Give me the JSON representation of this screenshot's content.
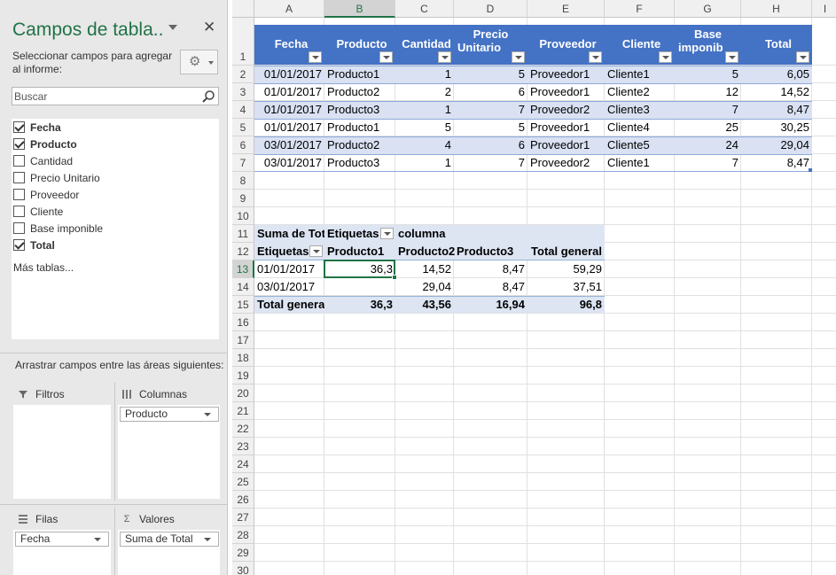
{
  "pane": {
    "title": "Campos de tabla..",
    "close_glyph": "✕",
    "subtitle": "Seleccionar campos para agregar al informe:",
    "search_placeholder": "Buscar",
    "fields": [
      {
        "label": "Fecha",
        "checked": true
      },
      {
        "label": "Producto",
        "checked": true
      },
      {
        "label": "Cantidad",
        "checked": false
      },
      {
        "label": "Precio Unitario",
        "checked": false
      },
      {
        "label": "Proveedor",
        "checked": false
      },
      {
        "label": "Cliente",
        "checked": false
      },
      {
        "label": "Base imponible",
        "checked": false
      },
      {
        "label": "Total",
        "checked": true
      }
    ],
    "more_tables": "Más tablas...",
    "drag_label": "Arrastrar campos entre las áreas siguientes:",
    "areas": {
      "filters": {
        "label": "Filtros",
        "icon": "filter-icon"
      },
      "columns": {
        "label": "Columnas",
        "icon": "columns-icon",
        "item": "Producto"
      },
      "rows": {
        "label": "Filas",
        "icon": "rows-icon",
        "item": "Fecha"
      },
      "values": {
        "label": "Valores",
        "icon": "sigma-icon",
        "item": "Suma de Total"
      }
    }
  },
  "sheet": {
    "columns": [
      "A",
      "B",
      "C",
      "D",
      "E",
      "F",
      "G",
      "H",
      "I"
    ],
    "active_column": "B",
    "active_row": 13,
    "visible_rows": 30,
    "table": {
      "headers": [
        "Fecha",
        "Producto",
        "Cantidad",
        "Precio Unitario",
        "Proveedor",
        "Cliente",
        "Base imponible",
        "Total"
      ],
      "header_display": [
        "Fecha",
        "Producto",
        "Cantidad",
        "Precio|Unitario",
        "Proveedor",
        "Cliente",
        "Base|imponib",
        "Total"
      ],
      "rows": [
        [
          "01/01/2017",
          "Producto1",
          "1",
          "5",
          "Proveedor1",
          "Cliente1",
          "5",
          "6,05"
        ],
        [
          "01/01/2017",
          "Producto2",
          "2",
          "6",
          "Proveedor1",
          "Cliente2",
          "12",
          "14,52"
        ],
        [
          "01/01/2017",
          "Producto3",
          "1",
          "7",
          "Proveedor2",
          "Cliente3",
          "7",
          "8,47"
        ],
        [
          "01/01/2017",
          "Producto1",
          "5",
          "5",
          "Proveedor1",
          "Cliente4",
          "25",
          "30,25"
        ],
        [
          "03/01/2017",
          "Producto2",
          "4",
          "6",
          "Proveedor1",
          "Cliente5",
          "24",
          "29,04"
        ],
        [
          "03/01/2017",
          "Producto3",
          "1",
          "7",
          "Proveedor2",
          "Cliente1",
          "7",
          "8,47"
        ]
      ]
    },
    "pivot": {
      "row11": [
        "Suma de Tot",
        "Etiquetas",
        "columna"
      ],
      "row12": [
        "Etiquetas",
        "Producto1",
        "Producto2",
        "Producto3",
        "Total general"
      ],
      "rows": [
        [
          "01/01/2017",
          "36,3",
          "14,52",
          "8,47",
          "59,29"
        ],
        [
          "03/01/2017",
          "",
          "29,04",
          "8,47",
          "37,51"
        ]
      ],
      "total": [
        "Total genera",
        "36,3",
        "43,56",
        "16,94",
        "96,8"
      ]
    },
    "colors": {
      "table_header": "#4472c4",
      "band": "#d9e1f2",
      "excel_green": "#217346"
    }
  }
}
